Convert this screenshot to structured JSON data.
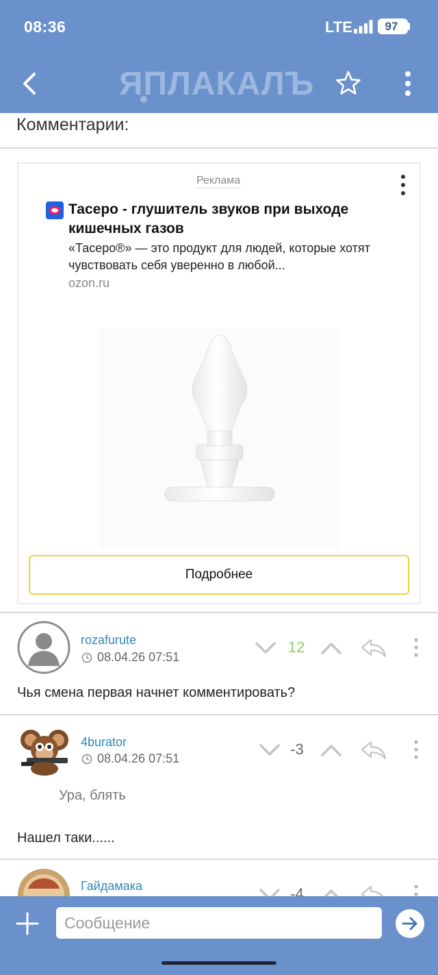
{
  "status_bar": {
    "time": "08:36",
    "network": "LTE",
    "battery": "97"
  },
  "header": {
    "logo_text": "ЯПЛАКАЛЪ",
    "back_icon": "chevron-left-icon",
    "star_icon": "star-outline-icon",
    "menu_icon": "vertical-dots-icon"
  },
  "section": {
    "title": "Комментарии:"
  },
  "ad": {
    "label": "Реклама",
    "title": "Тасеро - глушитель звуков при выходе кишечных газов",
    "description": "«Тасеро®» — это продукт для людей, которые хотят чувствовать себя уверенно в любой...",
    "domain": "ozon.ru",
    "cta": "Подробнее"
  },
  "comments": [
    {
      "username": "rozafurute",
      "datetime": "08.04.26 07:51",
      "score": "12",
      "score_color": "#8ccf6b",
      "text": "Чья смена первая начнет комментировать?"
    },
    {
      "username": "4burator",
      "datetime": "08.04.26 07:51",
      "score": "-3",
      "score_color": "#666666",
      "quote": "Ура, блять",
      "text": "Нашел таки......"
    },
    {
      "username": "Гайдамака",
      "score": "-4"
    }
  ],
  "composer": {
    "placeholder": "Сообщение"
  },
  "colors": {
    "brand_blue": "#6a91cc",
    "link_blue": "#2f88b8",
    "cta_border": "#f2d13a"
  }
}
